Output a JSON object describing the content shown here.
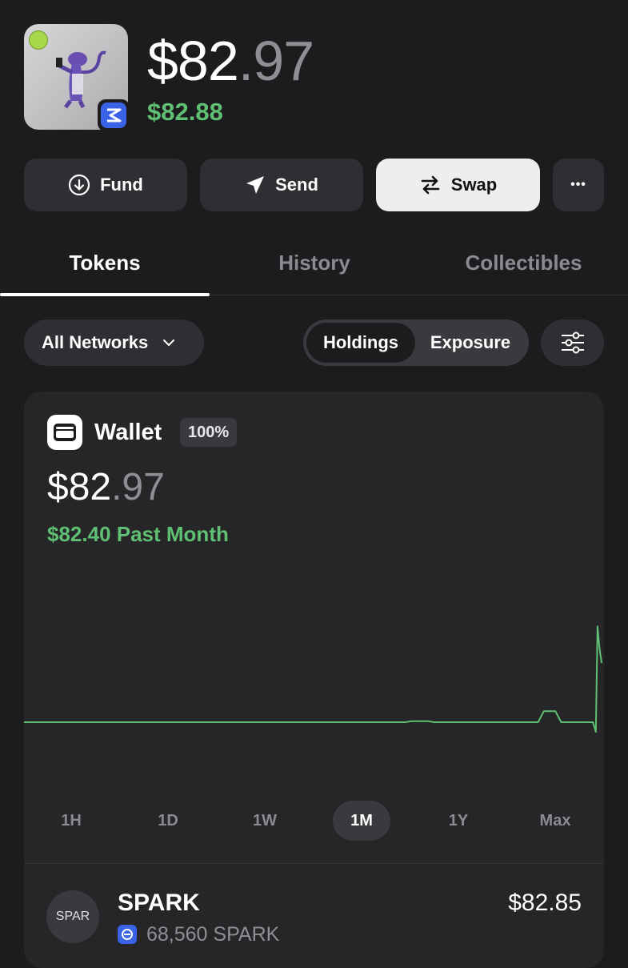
{
  "header": {
    "balance_whole": "$82",
    "balance_cents": ".97",
    "sub_balance": "$82.88"
  },
  "actions": {
    "fund_label": "Fund",
    "send_label": "Send",
    "swap_label": "Swap",
    "more_label": "•••"
  },
  "tabs": [
    {
      "label": "Tokens",
      "active": true
    },
    {
      "label": "History",
      "active": false
    },
    {
      "label": "Collectibles",
      "active": false
    }
  ],
  "filters": {
    "network_label": "All Networks",
    "segment_on": "Holdings",
    "segment_off": "Exposure"
  },
  "wallet_card": {
    "title": "Wallet",
    "percent": "100%",
    "balance_whole": "$82",
    "balance_cents": ".97",
    "change": "$82.40 Past Month"
  },
  "ranges": [
    {
      "label": "1H",
      "active": false
    },
    {
      "label": "1D",
      "active": false
    },
    {
      "label": "1W",
      "active": false
    },
    {
      "label": "1M",
      "active": true
    },
    {
      "label": "1Y",
      "active": false
    },
    {
      "label": "Max",
      "active": false
    }
  ],
  "token": {
    "logo_text": "SPAR",
    "name": "SPARK",
    "amount": "68,560 SPARK",
    "value": "$82.85"
  },
  "colors": {
    "background": "#1c1c1f",
    "positive": "#5fbf72",
    "chain_blue": "#3a63e8"
  },
  "chart_data": {
    "type": "line",
    "series": [
      {
        "x": [
          0,
          0.25,
          0.5,
          0.66,
          0.67,
          0.7,
          0.71,
          0.89,
          0.9,
          0.92,
          0.93,
          0.985,
          0.99,
          0.993,
          0.996,
          1.0
        ],
        "values": [
          0.3,
          0.3,
          0.3,
          0.3,
          0.6,
          0.6,
          0.3,
          0.3,
          3.6,
          3.6,
          0.3,
          0.3,
          -2.6,
          29.0,
          23.0,
          18.0
        ]
      }
    ],
    "grid": false,
    "legend": "none"
  }
}
